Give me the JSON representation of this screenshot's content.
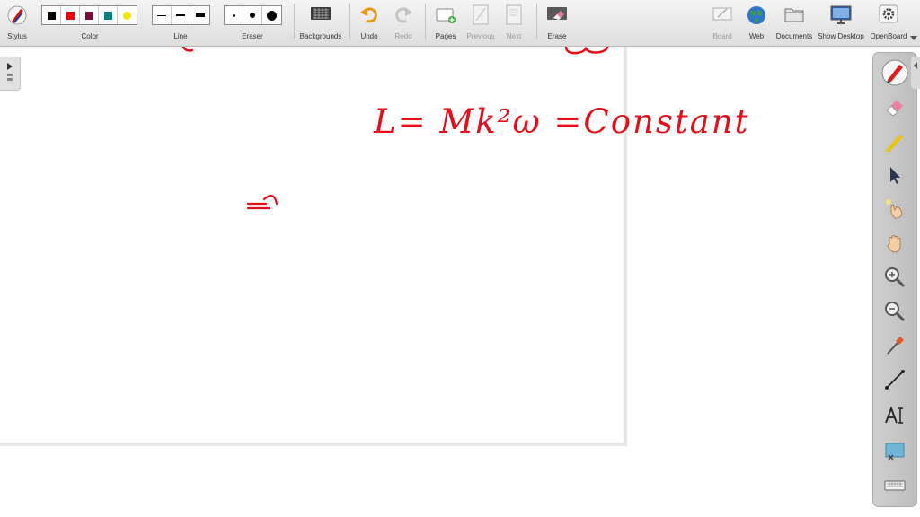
{
  "toolbar": {
    "stylus": "Stylus",
    "color": "Color",
    "line": "Line",
    "eraser": "Eraser",
    "backgrounds": "Backgrounds",
    "undo": "Undo",
    "redo": "Redo",
    "pages": "Pages",
    "previous": "Previous",
    "next": "Next",
    "erase": "Erase",
    "board": "Board",
    "web": "Web",
    "documents": "Documents",
    "show_desktop": "Show Desktop",
    "openboard": "OpenBoard"
  },
  "colors": [
    "#000000",
    "#e8000a",
    "#7b0a3a",
    "#0b7f7f",
    "#f5e400"
  ],
  "board": {
    "equation": "L= Mk²ω =Constant"
  },
  "icons": {
    "right_panel": [
      "pen-icon",
      "eraser-icon",
      "highlighter-icon",
      "pointer-icon",
      "laser-pointer-icon",
      "hand-icon",
      "zoom-in-icon",
      "zoom-out-icon",
      "capture-icon",
      "line-icon",
      "text-icon",
      "screen-capture-icon",
      "keyboard-icon"
    ]
  }
}
